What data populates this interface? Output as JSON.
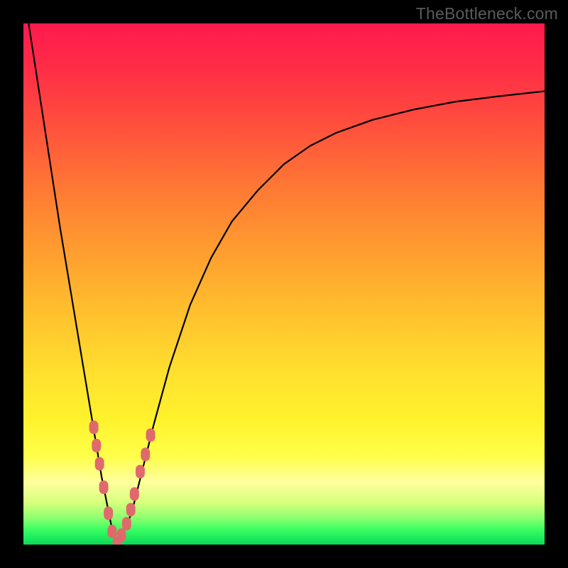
{
  "watermark": "TheBottleneck.com",
  "colors": {
    "frame": "#000000",
    "curve": "#000000",
    "marker_fill": "#e06a6b",
    "marker_stroke": "#c24b4c"
  },
  "chart_data": {
    "type": "line",
    "title": "",
    "xlabel": "",
    "ylabel": "",
    "xlim": [
      0,
      100
    ],
    "ylim": [
      0,
      100
    ],
    "notes": "V-shaped bottleneck curve. y=0 (green) optimal, y=100 (red) worst. Valley at ~x=18.",
    "series": [
      {
        "name": "bottleneck-curve",
        "x": [
          1,
          3,
          5,
          7,
          9,
          11,
          12,
          13,
          14,
          15,
          16,
          17,
          18,
          19,
          20,
          21,
          22,
          23,
          25,
          28,
          32,
          36,
          40,
          45,
          50,
          55,
          60,
          67,
          75,
          83,
          91,
          100
        ],
        "values": [
          100,
          87,
          74,
          61,
          49,
          37,
          31,
          25,
          19,
          13,
          8,
          3,
          0,
          2,
          4,
          7,
          11,
          15,
          23,
          34,
          46,
          55,
          62,
          68,
          73,
          76.5,
          79,
          81.5,
          83.5,
          85,
          86,
          87
        ]
      }
    ],
    "markers": {
      "name": "highlighted-points",
      "x": [
        13.5,
        14.0,
        14.6,
        15.4,
        16.3,
        17.0,
        18.0,
        18.8,
        19.8,
        20.6,
        21.3,
        22.4,
        23.4,
        24.4
      ],
      "values": [
        22.5,
        19.0,
        15.5,
        11.0,
        6.0,
        2.5,
        0.3,
        1.8,
        4.0,
        6.7,
        9.7,
        14.0,
        17.3,
        21.0
      ]
    }
  }
}
